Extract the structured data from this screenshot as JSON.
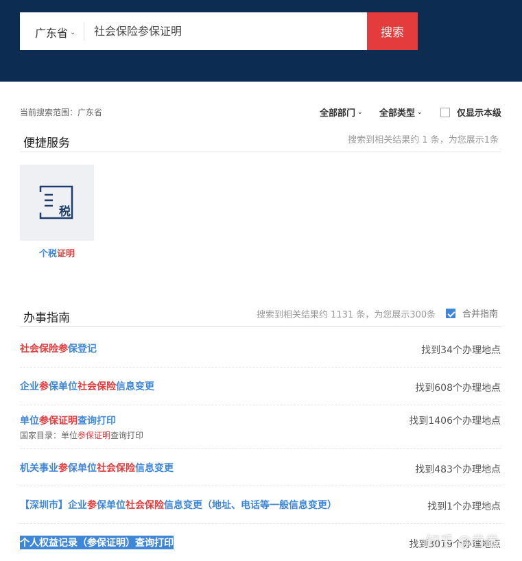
{
  "header": {
    "region": "广东省",
    "query": "社会保险参保证明",
    "search_button": "搜索"
  },
  "filters": {
    "scope_label": "当前搜索范围：广东省",
    "department": "全部部门",
    "type": "全部类型",
    "local_only": "仅显示本级",
    "local_only_checked": false
  },
  "quick_services": {
    "title": "便捷服务",
    "meta": "搜索到相关结果约 1 条，为您展示1条",
    "items": [
      {
        "icon": "tax-icon",
        "icon_text": "税",
        "label_plain": "个税",
        "label_hl": "证明"
      }
    ]
  },
  "guides": {
    "title": "办事指南",
    "meta": "搜索到相关结果约 1131 条，为您展示300条",
    "merge_label": "合并指南",
    "merge_checked": true,
    "rows": [
      {
        "parts": [
          [
            "社会保险参",
            true
          ],
          [
            "保登记",
            false
          ]
        ],
        "count": "找到34个办理地点"
      },
      {
        "parts": [
          [
            "企业",
            false
          ],
          [
            "参",
            true
          ],
          [
            "保单位",
            false
          ],
          [
            "社会保险",
            true
          ],
          [
            "信息变更",
            false
          ]
        ],
        "count": "找到608个办理地点"
      },
      {
        "parts": [
          [
            "单位",
            false
          ],
          [
            "参保证明",
            true
          ],
          [
            "查询打印",
            false
          ]
        ],
        "count": "找到1406个办理地点",
        "sub": [
          [
            "国家目录：单位",
            false
          ],
          [
            "参保证明",
            true
          ],
          [
            "查询打印",
            false
          ]
        ]
      },
      {
        "parts": [
          [
            "机关事业",
            false
          ],
          [
            "参",
            true
          ],
          [
            "保单位",
            false
          ],
          [
            "社会保险",
            true
          ],
          [
            "信息变更",
            false
          ]
        ],
        "count": "找到483个办理地点"
      },
      {
        "parts": [
          [
            "【深圳市】企业",
            false
          ],
          [
            "参",
            true
          ],
          [
            "保单位",
            false
          ],
          [
            "社会保险",
            true
          ],
          [
            "信息变更（地址、电话等一般信息变更）",
            false
          ]
        ],
        "count": "找到1个办理地点"
      },
      {
        "parts": [
          [
            "个人权益记录（参保证明）查询打印",
            false
          ]
        ],
        "count": "找到3019个办理地点",
        "selected": true
      }
    ]
  },
  "watermark": "知乎 @卷卷"
}
